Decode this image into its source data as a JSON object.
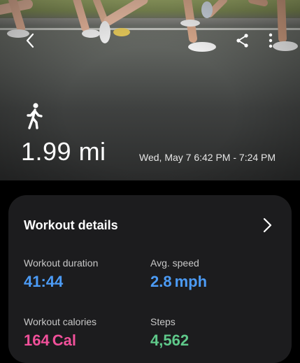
{
  "hero": {
    "distance": "1.99 mi",
    "date_range": "Wed, May 7 6:42 PM - 7:24 PM",
    "icons": [
      "back-icon",
      "share-icon",
      "more-vertical-icon",
      "walking-icon"
    ]
  },
  "card": {
    "title": "Workout details",
    "metrics": [
      {
        "label": "Workout duration",
        "value": "41:44",
        "unit": "",
        "color": "#4c9bf5"
      },
      {
        "label": "Avg. speed",
        "value": "2.8",
        "unit": "mph",
        "color": "#4c9bf5"
      },
      {
        "label": "Workout calories",
        "value": "164",
        "unit": "Cal",
        "color": "#f0509a"
      },
      {
        "label": "Steps",
        "value": "4,562",
        "unit": "",
        "color": "#5fc98a"
      }
    ]
  }
}
